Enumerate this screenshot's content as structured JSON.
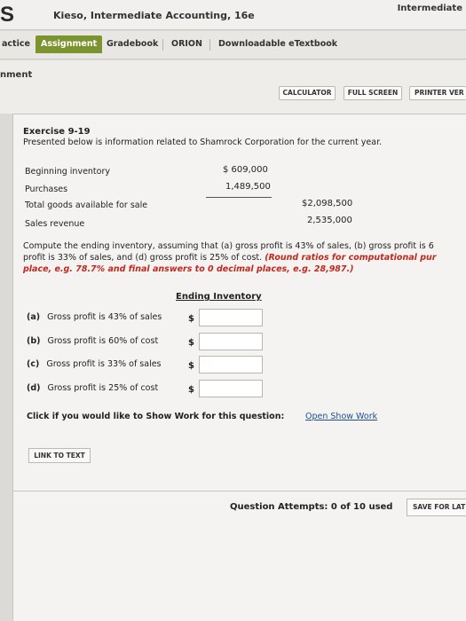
{
  "header": {
    "logo": "S",
    "title": "Kieso, Intermediate Accounting, 16e",
    "right_link": "Intermediate"
  },
  "nav": {
    "tabs": [
      {
        "label": "actice"
      },
      {
        "label": "Assignment"
      },
      {
        "label": "Gradebook"
      },
      {
        "label": "ORION"
      },
      {
        "label": "Downloadable eTextbook"
      }
    ],
    "active": "Assignment",
    "active_color": "#7b9430"
  },
  "strip": {
    "title": "nment",
    "buttons": [
      "CALCULATOR",
      "FULL SCREEN",
      "PRINTER VER"
    ]
  },
  "exercise": {
    "title": "Exercise 9-19",
    "intro": "Presented below is information related to Shamrock Corporation for the current year.",
    "inventory": [
      {
        "label": "Beginning inventory",
        "value": "$ 609,000"
      },
      {
        "label": "Purchases",
        "value": "1,489,500"
      },
      {
        "label": "Total goods available for sale",
        "value": "$2,098,500"
      },
      {
        "label": "Sales revenue",
        "value": "2,535,000"
      }
    ],
    "question_line1": "Compute the ending inventory, assuming that (a) gross profit is 43% of sales, (b) gross profit is 6",
    "question_line2_plain": "profit is 33% of sales, and (d) gross profit is 25% of cost. ",
    "question_line2_red": "(Round ratios for computational pur",
    "question_line3_red": "place, e.g. 78.7% and final answers to 0 decimal places, e.g. 28,987.)",
    "column_header": "Ending Inventory",
    "rows": [
      {
        "letter": "(a)",
        "label": "Gross profit is 43% of sales",
        "currency": "$",
        "value": ""
      },
      {
        "letter": "(b)",
        "label": "Gross profit is 60% of cost",
        "currency": "$",
        "value": ""
      },
      {
        "letter": "(c)",
        "label": "Gross profit is 33% of sales",
        "currency": "$",
        "value": ""
      },
      {
        "letter": "(d)",
        "label": "Gross profit is 25% of cost",
        "currency": "$",
        "value": ""
      }
    ],
    "show_work_prompt": "Click if you would like to Show Work for this question:",
    "show_work_link": "Open Show Work",
    "link_to_text": "LINK TO TEXT",
    "attempts": "Question Attempts: 0 of 10 used",
    "save_label": "SAVE FOR LAT"
  },
  "colors": {
    "red_instructions": "#c0281e",
    "link": "#1f4f8f"
  }
}
